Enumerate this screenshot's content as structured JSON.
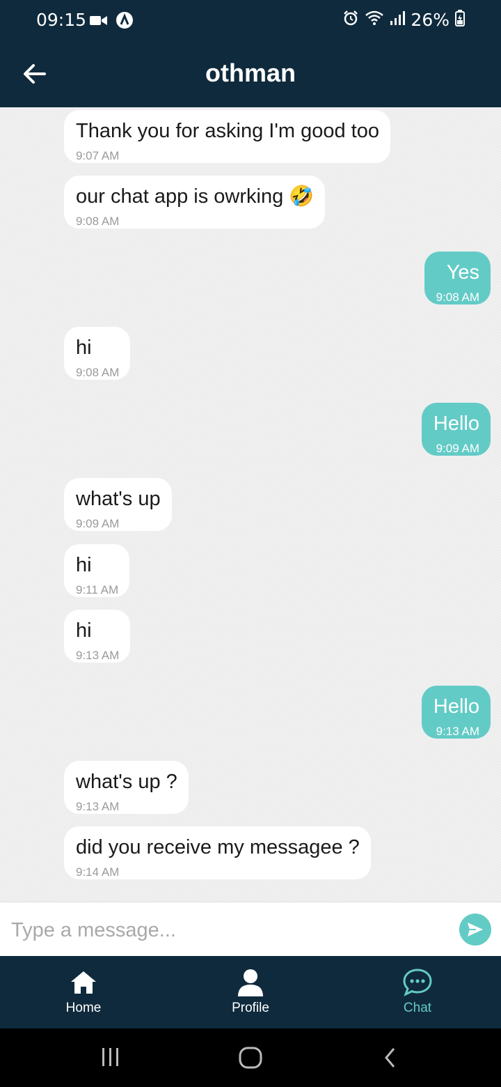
{
  "status_bar": {
    "time": "09:15",
    "battery": "26%",
    "icons": [
      "video-camera-icon",
      "vpn-a-icon",
      "alarm-icon",
      "wifi-icon",
      "signal-icon",
      "battery-charging-icon"
    ]
  },
  "header": {
    "title": "othman",
    "back_icon": "arrow-left-icon"
  },
  "messages": [
    {
      "direction": "in",
      "text": "Thank you for asking I'm good too",
      "time": "9:07 AM"
    },
    {
      "direction": "in",
      "text": "our chat app is owrking 🤣",
      "time": "9:08 AM"
    },
    {
      "direction": "out",
      "text": "Yes",
      "time": "9:08 AM"
    },
    {
      "direction": "in",
      "text": "hi",
      "time": "9:08 AM"
    },
    {
      "direction": "out",
      "text": "Hello",
      "time": "9:09 AM"
    },
    {
      "direction": "in",
      "text": "what's up",
      "time": "9:09 AM"
    },
    {
      "direction": "in",
      "text": "hi",
      "time": "9:11 AM"
    },
    {
      "direction": "in",
      "text": "hi",
      "time": "9:13 AM"
    },
    {
      "direction": "out",
      "text": "Hello",
      "time": "9:13 AM"
    },
    {
      "direction": "in",
      "text": "what's up ?",
      "time": "9:13 AM"
    },
    {
      "direction": "in",
      "text": "did you receive my messagee ?",
      "time": "9:14 AM"
    }
  ],
  "composer": {
    "placeholder": "Type a message...",
    "send_icon": "send-icon"
  },
  "tabs": [
    {
      "label": "Home",
      "icon": "home-icon",
      "active": false
    },
    {
      "label": "Profile",
      "icon": "user-icon",
      "active": false
    },
    {
      "label": "Chat",
      "icon": "chat-bubble-icon",
      "active": true
    }
  ],
  "colors": {
    "header_bg": "#0f2a3c",
    "accent": "#63cbc6",
    "incoming_bubble": "#ffffff"
  }
}
